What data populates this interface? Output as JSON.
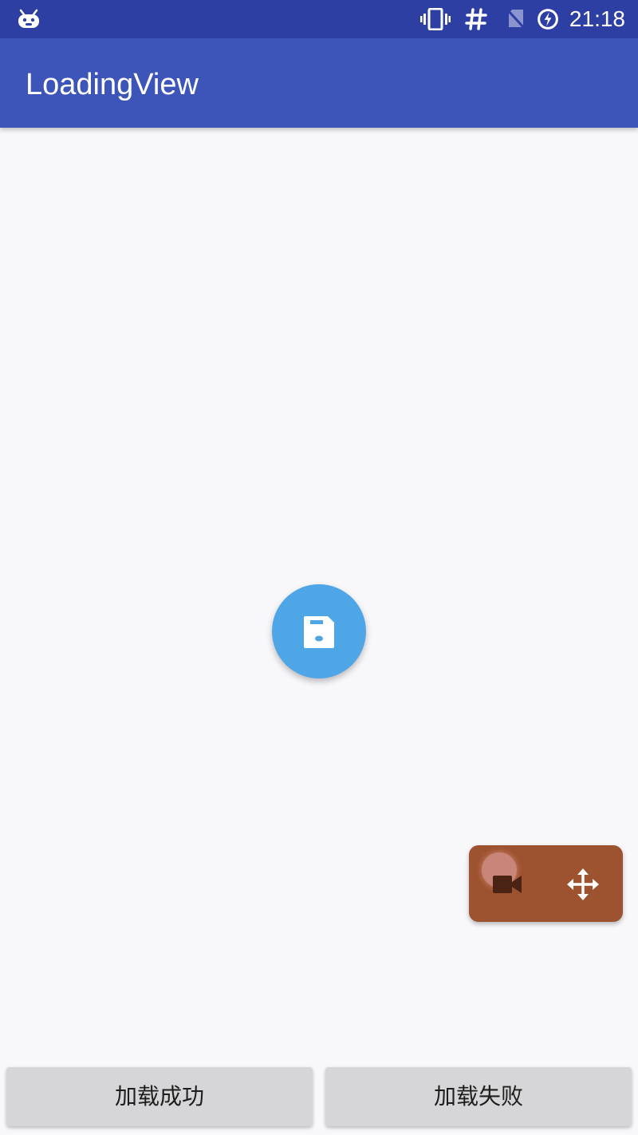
{
  "status_bar": {
    "time": "21:18",
    "icons": [
      "android-notification-icon",
      "vibrate-icon",
      "hash-icon",
      "no-sim-icon",
      "battery-charging-icon"
    ],
    "background_color": "#2e3fa3"
  },
  "app_bar": {
    "title": "LoadingView",
    "background_color": "#3d55b9"
  },
  "loading_indicator": {
    "icon": "save-icon",
    "color": "#4fa6e6"
  },
  "floating_panel": {
    "icons": [
      "record-icon",
      "camera-icon",
      "move-icon"
    ],
    "color": "#9d5230"
  },
  "buttons": {
    "success_label": "加载成功",
    "fail_label": "加载失败"
  }
}
